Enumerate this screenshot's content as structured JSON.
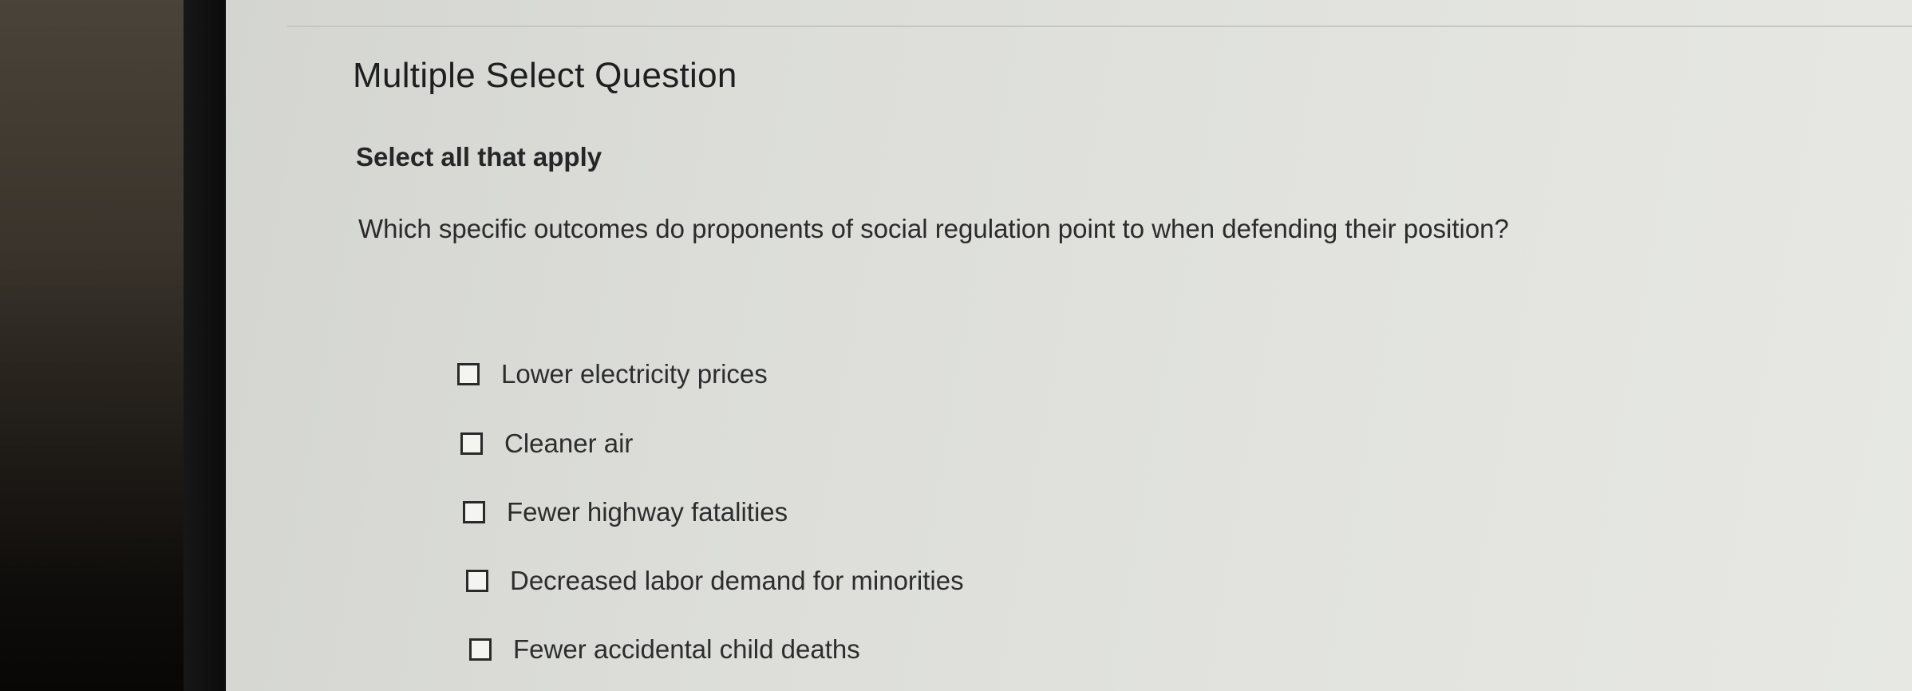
{
  "question": {
    "type_title": "Multiple Select Question",
    "instruction": "Select all that apply",
    "prompt": "Which specific outcomes do proponents of social regulation point to when defending their position?"
  },
  "options": [
    {
      "label": "Lower electricity prices",
      "checked": false
    },
    {
      "label": "Cleaner air",
      "checked": false
    },
    {
      "label": "Fewer highway fatalities",
      "checked": false
    },
    {
      "label": "Decreased labor demand for minorities",
      "checked": false
    },
    {
      "label": "Fewer accidental child deaths",
      "checked": false
    }
  ],
  "colors": {
    "screen_background": "#dcddd9",
    "text": "#2b2b2b",
    "checkbox_border": "#2a2a2a"
  }
}
